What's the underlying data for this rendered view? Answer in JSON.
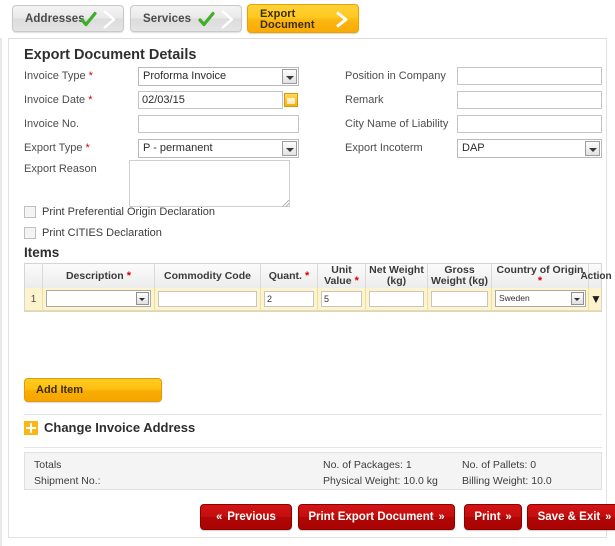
{
  "wizard": {
    "tabs": [
      {
        "label": "Addresses",
        "state": "done"
      },
      {
        "label": "Services",
        "state": "done"
      },
      {
        "label": "Export\nDocument",
        "state": "active"
      }
    ]
  },
  "section": {
    "title": "Export Document Details"
  },
  "form": {
    "left": [
      {
        "label": "Invoice Type",
        "required": true,
        "type": "select",
        "value": "Proforma Invoice"
      },
      {
        "label": "Invoice Date",
        "required": true,
        "type": "date",
        "value": "02/03/15"
      },
      {
        "label": "Invoice No.",
        "required": false,
        "type": "text",
        "value": ""
      },
      {
        "label": "Export Type",
        "required": true,
        "type": "select",
        "value": "P - permanent"
      },
      {
        "label": "Export Reason",
        "required": false,
        "type": "textarea",
        "value": ""
      }
    ],
    "right": [
      {
        "label": "Position in Company",
        "required": false,
        "type": "text",
        "value": ""
      },
      {
        "label": "Remark",
        "required": false,
        "type": "text",
        "value": ""
      },
      {
        "label": "City Name of Liability",
        "required": false,
        "type": "text",
        "value": ""
      },
      {
        "label": "Export Incoterm",
        "required": false,
        "type": "select",
        "value": "DAP"
      }
    ]
  },
  "checkboxes": [
    {
      "label": "Print Preferential Origin Declaration",
      "checked": false
    },
    {
      "label": "Print CITIES Declaration",
      "checked": false
    }
  ],
  "items": {
    "title": "Items",
    "columns": [
      {
        "label": "",
        "required": false
      },
      {
        "label": "Description",
        "required": true
      },
      {
        "label": "Commodity Code",
        "required": false
      },
      {
        "label": "Quant.",
        "required": true
      },
      {
        "label": "Unit",
        "label2": "Value",
        "required": true
      },
      {
        "label": "Net Weight",
        "label2": "(kg)",
        "required": false
      },
      {
        "label": "Gross",
        "label2": "Weight (kg)",
        "required": false
      },
      {
        "label": "Country of Origin",
        "required": true
      },
      {
        "label": "Action",
        "required": false
      }
    ],
    "rows": [
      {
        "no": "1",
        "description": "",
        "commodity_code": "",
        "quantity": "2",
        "unit_value": "5",
        "net_weight": "",
        "gross_weight": "",
        "country_of_origin": "Sweden",
        "action": "▼"
      }
    ],
    "add_item_label": "Add Item"
  },
  "expander": {
    "label": "Change Invoice Address",
    "icon": "plus-icon"
  },
  "totals": {
    "label": "Totals",
    "shipment_no_label": "Shipment No.:",
    "shipment_no_value": "",
    "packages_label": "No. of Packages:",
    "packages_value": "1",
    "pallets_label": "No. of Pallets:",
    "pallets_value": "0",
    "physical_weight_label": "Physical Weight:",
    "physical_weight_value": "10.0 kg",
    "billing_weight_label": "Billing Weight:",
    "billing_weight_value": "10.0"
  },
  "footer": {
    "buttons": [
      {
        "name": "previous",
        "label": "Previous",
        "chevron": "«",
        "chevron_side": "left"
      },
      {
        "name": "print-export-document",
        "label": "Print Export Document",
        "chevron": "»",
        "chevron_side": "right"
      },
      {
        "name": "print",
        "label": "Print",
        "chevron": "»",
        "chevron_side": "right"
      },
      {
        "name": "save-and-exit",
        "label": "Save & Exit",
        "chevron": "»",
        "chevron_side": "right"
      }
    ]
  },
  "colors": {
    "accent_yellow": "#fcb813",
    "button_red": "#c40d0d",
    "required_star": "#d60000",
    "row_highlight": "#fdf3cd",
    "check_green": "#3fae2a"
  }
}
